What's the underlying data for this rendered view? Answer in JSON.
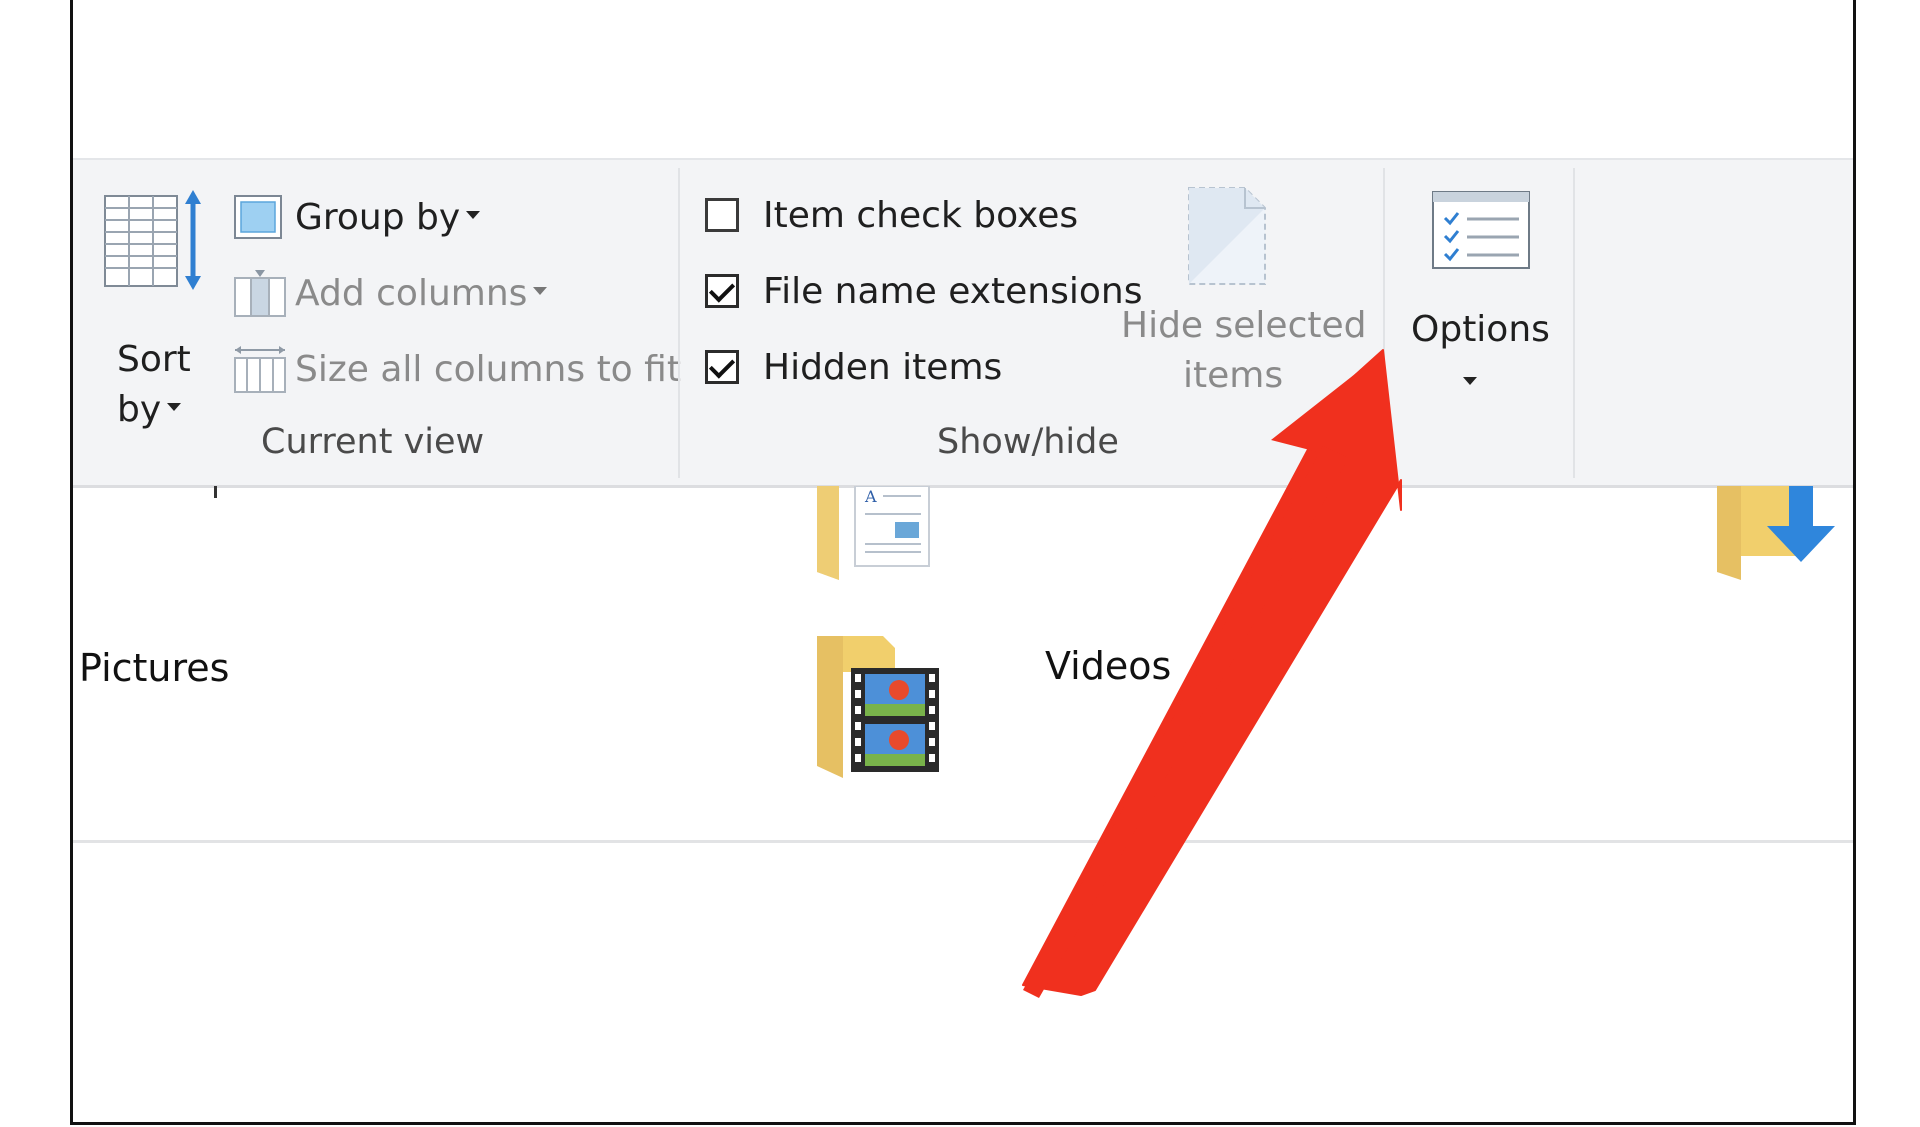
{
  "ribbon": {
    "current_view": {
      "sort_by_label_line1": "Sort",
      "sort_by_label_line2": "by",
      "group_by_label": "Group by",
      "add_columns_label": "Add columns",
      "size_all_columns_label": "Size all columns to fit",
      "group_label": "Current view"
    },
    "show_hide": {
      "item_check_boxes": {
        "label": "Item check boxes",
        "checked": false
      },
      "file_name_extensions": {
        "label": "File name extensions",
        "checked": true
      },
      "hidden_items": {
        "label": "Hidden items",
        "checked": true
      },
      "hide_selected_label_line1": "Hide selected",
      "hide_selected_label_line2": "items",
      "group_label": "Show/hide"
    },
    "options": {
      "label": "Options"
    }
  },
  "files": {
    "items": [
      {
        "name": "Pictures",
        "icon": "pictures-folder-icon"
      },
      {
        "name": "Videos",
        "icon": "videos-folder-icon"
      }
    ]
  },
  "annotation": {
    "arrow_color": "#f0301e"
  }
}
